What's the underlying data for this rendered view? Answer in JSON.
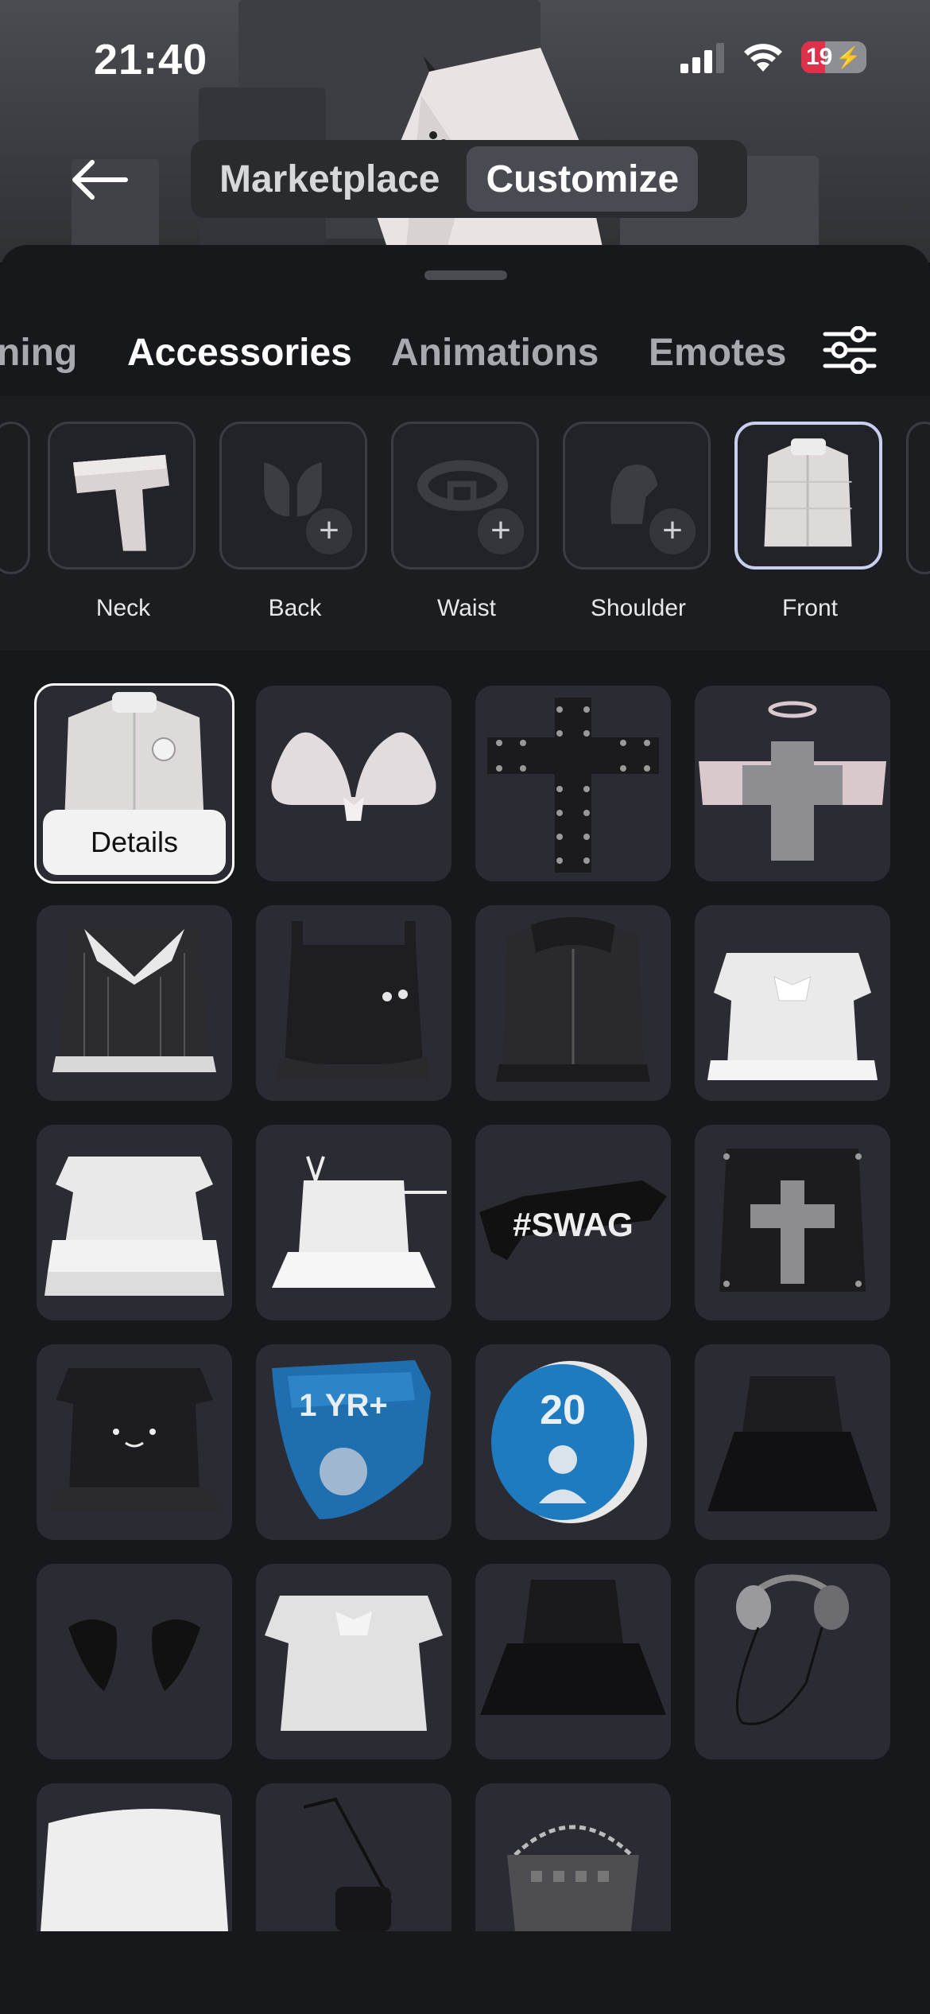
{
  "status": {
    "time": "21:40",
    "battery": "19"
  },
  "header": {
    "tabs": [
      "Marketplace",
      "Customize"
    ],
    "active_tab": "Customize"
  },
  "category_tabs": [
    "ning",
    "Accessories",
    "Animations",
    "Emotes"
  ],
  "active_category": "Accessories",
  "slots": [
    {
      "label": "Neck"
    },
    {
      "label": "Back"
    },
    {
      "label": "Waist"
    },
    {
      "label": "Shoulder"
    },
    {
      "label": "Front"
    }
  ],
  "details_label": "Details",
  "items": [
    {
      "name": "white-puffer-vest"
    },
    {
      "name": "white-bra"
    },
    {
      "name": "studded-cross-black"
    },
    {
      "name": "studded-cross-halo"
    },
    {
      "name": "pinstripe-lace-collar-top"
    },
    {
      "name": "black-bear-top"
    },
    {
      "name": "black-hooded-vest"
    },
    {
      "name": "white-bow-top"
    },
    {
      "name": "white-ruffle-dress"
    },
    {
      "name": "white-tube-top"
    },
    {
      "name": "swag-sign",
      "text": "#SWAG"
    },
    {
      "name": "black-cross-top"
    },
    {
      "name": "cat-face-top"
    },
    {
      "name": "one-year-badge",
      "text": "1 YR+"
    },
    {
      "name": "twenty-friends-coin",
      "text": "20"
    },
    {
      "name": "black-gothic-dress"
    },
    {
      "name": "black-fur-wings"
    },
    {
      "name": "white-blouse"
    },
    {
      "name": "black-ruffle-corset"
    },
    {
      "name": "headphones"
    },
    {
      "name": "white-pillow"
    },
    {
      "name": "black-crossbody-bag"
    },
    {
      "name": "checker-purse"
    }
  ]
}
